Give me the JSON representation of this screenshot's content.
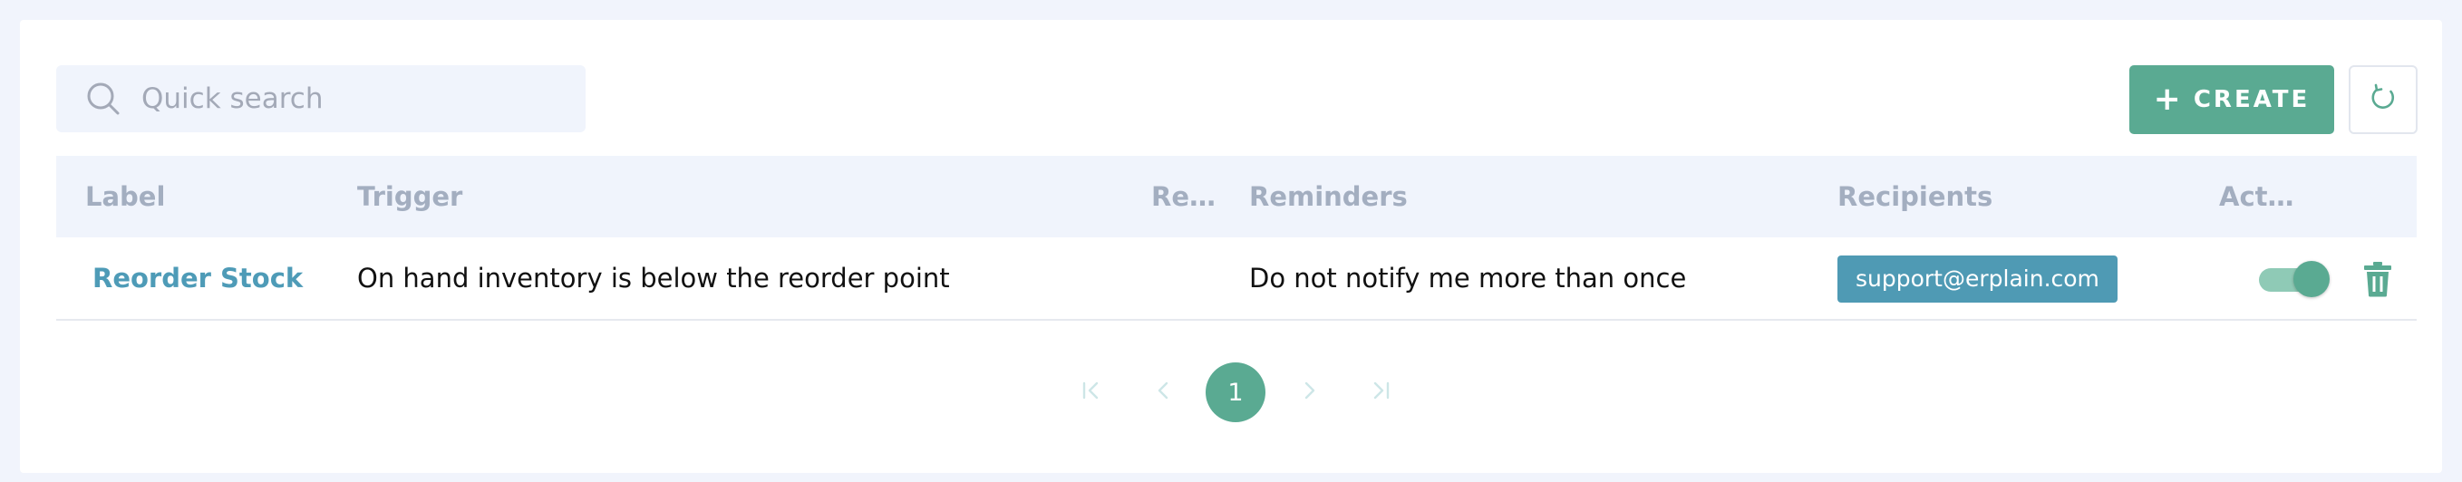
{
  "search": {
    "placeholder": "Quick search",
    "icon": "search-icon"
  },
  "toolbar": {
    "create_label": "CREATE",
    "create_icon": "plus-icon",
    "refresh_icon": "refresh-icon"
  },
  "table": {
    "columns": [
      "Label",
      "Trigger",
      "Rec...",
      "Reminders",
      "Recipients",
      "Acti..."
    ],
    "rows": [
      {
        "label": "Reorder Stock",
        "trigger": "On hand inventory is below the reorder point",
        "recurrence": "",
        "reminders": "Do not notify me more than once",
        "recipients": [
          "support@erplain.com"
        ],
        "active": true
      }
    ]
  },
  "pagination": {
    "current_page": "1",
    "first_icon": "first-page-icon",
    "prev_icon": "chevron-left-icon",
    "next_icon": "chevron-right-icon",
    "last_icon": "last-page-icon"
  },
  "colors": {
    "accent": "#5aaa92",
    "link": "#4e9bb7",
    "chip": "#4f9ab4",
    "header_bg": "#f0f4fc",
    "page_bg": "#f1f4fc"
  }
}
